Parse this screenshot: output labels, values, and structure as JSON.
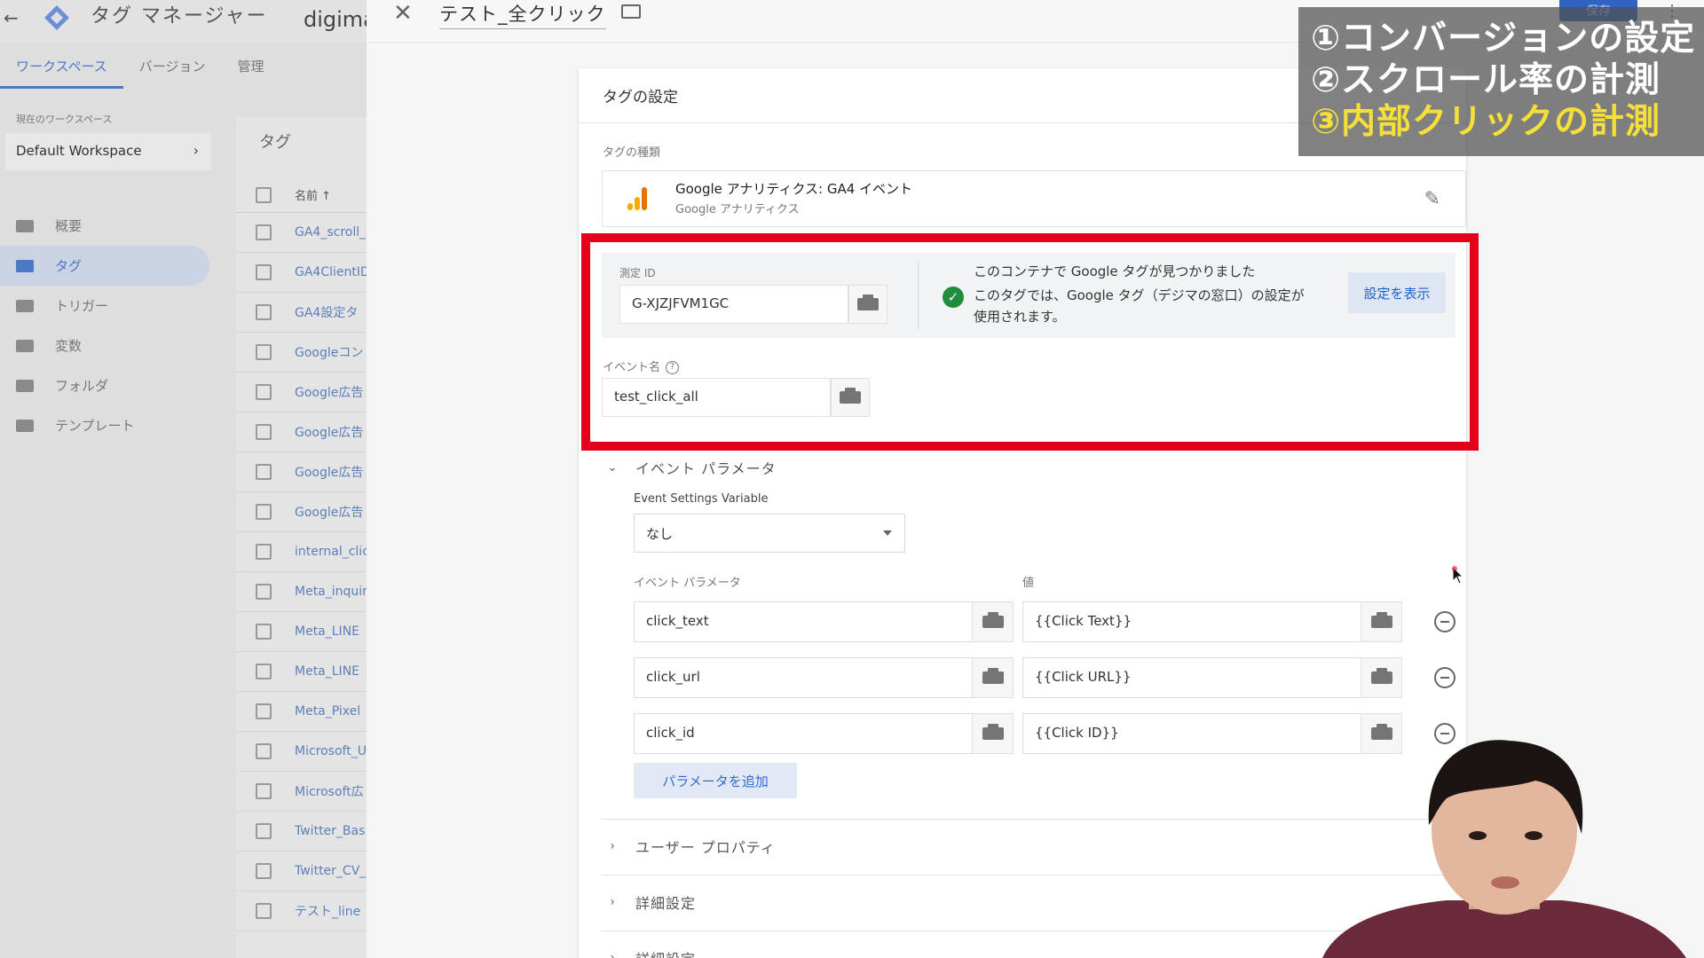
{
  "app": {
    "title": "タグ マネージャー",
    "account": "digima",
    "tabs": [
      "ワークスペース",
      "バージョン",
      "管理"
    ],
    "workspace_label": "現在のワークスペース",
    "workspace_name": "Default Workspace"
  },
  "sidebar": {
    "items": [
      {
        "label": "概要",
        "icon": "overview-icon"
      },
      {
        "label": "タグ",
        "icon": "tag-icon",
        "active": true
      },
      {
        "label": "トリガー",
        "icon": "trigger-icon"
      },
      {
        "label": "変数",
        "icon": "variables-icon"
      },
      {
        "label": "フォルダ",
        "icon": "folder-icon"
      },
      {
        "label": "テンプレート",
        "icon": "template-icon"
      }
    ]
  },
  "tag_list": {
    "title": "タグ",
    "column_name": "名前 ↑",
    "rows": [
      "GA4_scroll_",
      "GA4ClientID",
      "GA4設定タ",
      "Googleコン",
      "Google広告",
      "Google広告",
      "Google広告",
      "Google広告",
      "internal_clic",
      "Meta_inquir",
      "Meta_LINE",
      "Meta_LINE",
      "Meta_Pixel",
      "Microsoft_U",
      "Microsoft広",
      "Twitter_Bas",
      "Twitter_CV_",
      "テスト_line"
    ]
  },
  "sheet": {
    "tag_name": "テスト_全クリック",
    "save_label": "保存",
    "card_title": "タグの設定",
    "type_label": "タグの種類",
    "type_name": "Google アナリティクス: GA4 イベント",
    "type_sub": "Google アナリティクス",
    "measurement_id_label": "測定 ID",
    "measurement_id": "G-XJZJFVM1GC",
    "found_line1": "このコンテナで Google タグが見つかりました",
    "found_line2": "このタグでは、Google タグ（デジマの窓口）の設定が",
    "found_line3": "使用されます。",
    "show_settings_label": "設定を表示",
    "event_name_label": "イベント名",
    "event_name": "test_click_all",
    "event_params_section": "イベント パラメータ",
    "esv_label": "Event Settings Variable",
    "esv_value": "なし",
    "param_col_label": "イベント パラメータ",
    "value_col_label": "値",
    "params": [
      {
        "name": "click_text",
        "value": "{{Click Text}}"
      },
      {
        "name": "click_url",
        "value": "{{Click URL}}"
      },
      {
        "name": "click_id",
        "value": "{{Click ID}}"
      }
    ],
    "add_param_label": "パラメータを追加",
    "user_props_section": "ユーザー プロパティ",
    "advanced_section": "詳細設定",
    "extra_section": "詳細設定"
  },
  "annotations": [
    "①コンバージョンの設定",
    "②スクロール率の計測",
    "③内部クリックの計測"
  ],
  "colors": {
    "accent": "#1a73e8",
    "highlight_frame": "#e4001b",
    "annotation_highlight": "#f5e03a"
  }
}
